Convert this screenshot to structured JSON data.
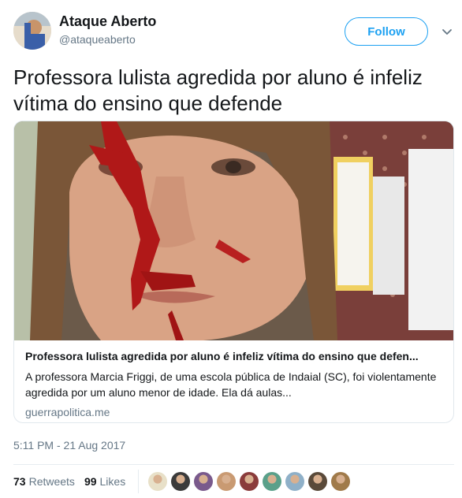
{
  "author": {
    "display_name": "Ataque Aberto",
    "handle": "@ataqueaberto",
    "avatar_icon": "avatar-photo"
  },
  "follow_button": {
    "label": "Follow",
    "color": "#1da1f2"
  },
  "menu_icon": "chevron-down-icon",
  "tweet": {
    "text": "Professora lulista agredida por aluno é infeliz vítima do ensino que defende"
  },
  "card": {
    "image_icon": "photo-image",
    "title": "Professora lulista agredida por aluno é infeliz vítima do ensino que defen...",
    "description": "A professora Marcia Friggi, de uma escola pública de Indaial (SC), foi violentamente agredida por um aluno menor de idade. Ela dá aulas...",
    "domain": "guerrapolitica.me"
  },
  "timestamp": "5:11 PM - 21 Aug 2017",
  "stats": {
    "retweets_count": "73",
    "retweets_label": "Retweets",
    "likes_count": "99",
    "likes_label": "Likes"
  },
  "liker_avatars": [
    {
      "color": "#e8e0c8"
    },
    {
      "color": "#3b3b3b"
    },
    {
      "color": "#7a5a8c"
    },
    {
      "color": "#c99a72"
    },
    {
      "color": "#8a3b3b"
    },
    {
      "color": "#5aa08a"
    },
    {
      "color": "#8fb0c8"
    },
    {
      "color": "#5a4a3a"
    },
    {
      "color": "#a07a4a"
    }
  ]
}
